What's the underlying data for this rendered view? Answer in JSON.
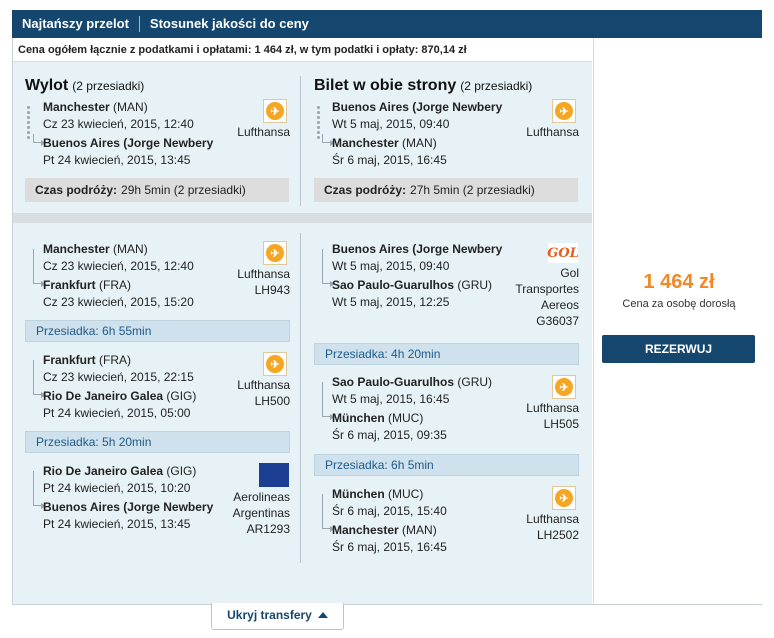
{
  "tabs": [
    {
      "label": "Najtańszy przelot"
    },
    {
      "label": "Stosunek jakości do ceny"
    }
  ],
  "price_summary": "Cena ogółem łącznie z podatkami i opłatami: 1 464 zł, w tym podatki i opłaty: 870,14 zł",
  "outbound": {
    "title": "Wylot",
    "stops": "(2 przesiadki)",
    "from_city": "Manchester",
    "from_code": "(MAN)",
    "from_time": "Cz 23 kwiecień, 2015, 12:40",
    "to_city": "Buenos Aires (Jorge Newbery",
    "to_time": "Pt 24 kwiecień, 2015, 13:45",
    "airline": "Lufthansa",
    "duration_label": "Czas podróży:",
    "duration": "29h 5min (2 przesiadki)",
    "segments": [
      {
        "from_city": "Manchester",
        "from_code": "(MAN)",
        "from_time": "Cz 23 kwiecień, 2015, 12:40",
        "to_city": "Frankfurt",
        "to_code": "(FRA)",
        "to_time": "Cz 23 kwiecień, 2015, 15:20",
        "airline": "Lufthansa",
        "flight": "LH943"
      },
      {
        "from_city": "Frankfurt",
        "from_code": "(FRA)",
        "from_time": "Cz 23 kwiecień, 2015, 22:15",
        "to_city": "Rio De Janeiro Galea",
        "to_code": "(GIG)",
        "to_time": "Pt 24 kwiecień, 2015, 05:00",
        "airline": "Lufthansa",
        "flight": "LH500"
      },
      {
        "from_city": "Rio De Janeiro Galea",
        "from_code": "(GIG)",
        "from_time": "Pt 24 kwiecień, 2015, 10:20",
        "to_city": "Buenos Aires (Jorge Newbery",
        "to_code": "",
        "to_time": "Pt 24 kwiecień, 2015, 13:45",
        "airline1": "Aerolineas",
        "airline2": "Argentinas",
        "flight": "AR1293"
      }
    ],
    "layovers": [
      "Przesiadka: 6h 55min",
      "Przesiadka: 5h 20min"
    ]
  },
  "inbound": {
    "title": "Bilet w obie strony",
    "stops": "(2 przesiadki)",
    "from_city": "Buenos Aires (Jorge Newbery",
    "from_time": "Wt 5 maj, 2015, 09:40",
    "to_city": "Manchester",
    "to_code": "(MAN)",
    "to_time": "Śr 6 maj, 2015, 16:45",
    "airline": "Lufthansa",
    "duration_label": "Czas podróży:",
    "duration": "27h 5min (2 przesiadki)",
    "segments": [
      {
        "from_city": "Buenos Aires (Jorge Newbery",
        "from_code": "",
        "from_time": "Wt 5 maj, 2015, 09:40",
        "to_city": "Sao Paulo-Guarulhos",
        "to_code": "(GRU)",
        "to_time": "Wt 5 maj, 2015, 12:25",
        "airline1": "Gol",
        "airline2": "Transportes",
        "airline3": "Aereos",
        "flight": "G36037"
      },
      {
        "from_city": "Sao Paulo-Guarulhos",
        "from_code": "(GRU)",
        "from_time": "Wt 5 maj, 2015, 16:45",
        "to_city": "München",
        "to_code": "(MUC)",
        "to_time": "Śr 6 maj, 2015, 09:35",
        "airline": "Lufthansa",
        "flight": "LH505"
      },
      {
        "from_city": "München",
        "from_code": "(MUC)",
        "from_time": "Śr 6 maj, 2015, 15:40",
        "to_city": "Manchester",
        "to_code": "(MAN)",
        "to_time": "Śr 6 maj, 2015, 16:45",
        "airline": "Lufthansa",
        "flight": "LH2502"
      }
    ],
    "layovers": [
      "Przesiadka: 4h 20min",
      "Przesiadka: 6h 5min"
    ]
  },
  "price": {
    "amount": "1 464 zł",
    "per": "Cena za osobę dorosłą",
    "book": "REZERWUJ"
  },
  "toggle": "Ukryj transfery",
  "icons": {
    "lufthansa": "lufthansa-crane-logo",
    "aerolineas": "aerolineas-argentinas-logo",
    "gol": "gol-logo"
  },
  "colors": {
    "accent": "#15466e",
    "price": "#f08a28",
    "pane": "#e6f2f6"
  }
}
